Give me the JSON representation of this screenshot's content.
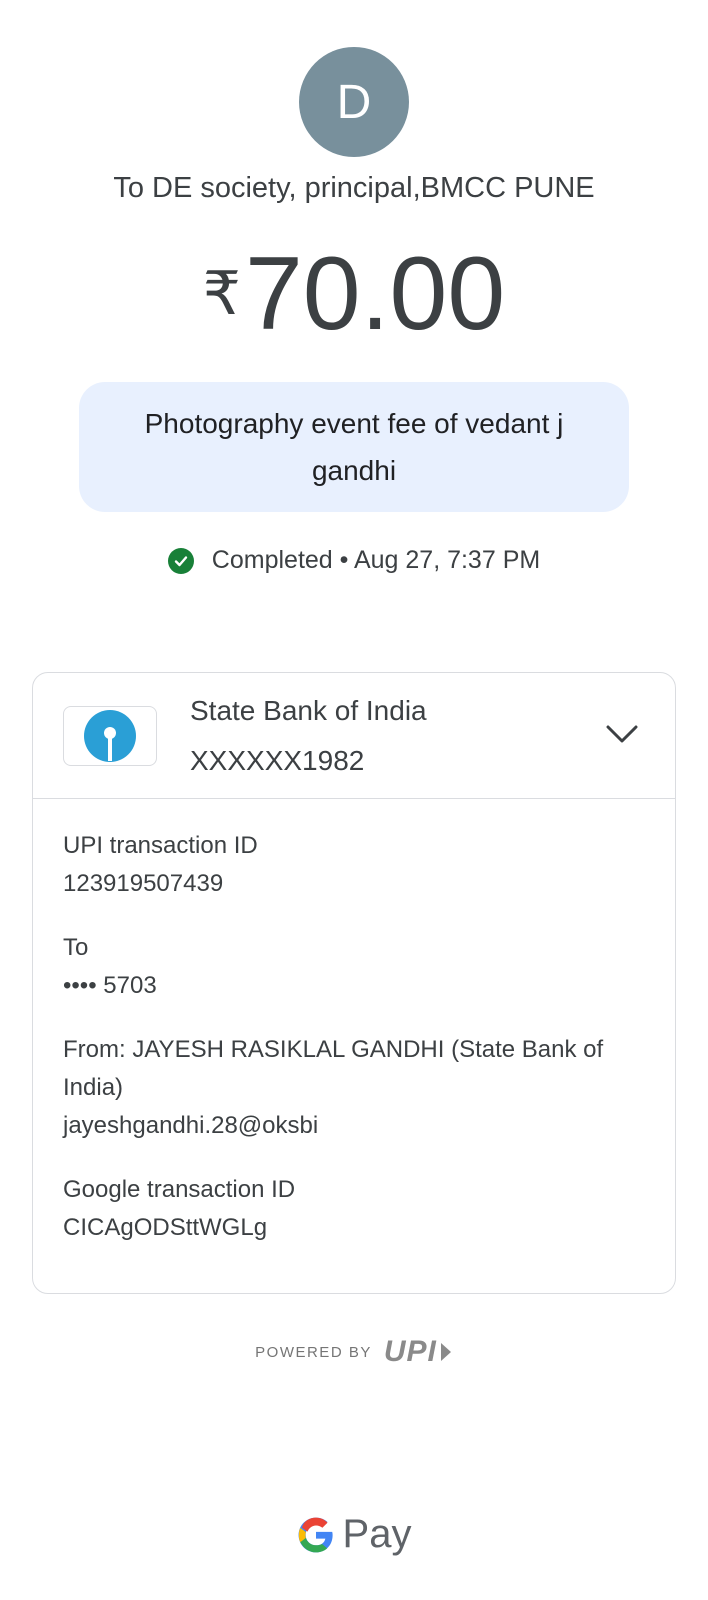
{
  "avatar": {
    "initial": "D",
    "color": "#78909c"
  },
  "payee": {
    "text": "To DE society, principal,BMCC PUNE"
  },
  "amount": {
    "currency": "₹",
    "value": "70.00"
  },
  "note": {
    "text": "Photography event fee of vedant j gandhi"
  },
  "status": {
    "text": "Completed • Aug 27, 7:37 PM",
    "icon": "check-circle-icon",
    "color": "#188038"
  },
  "account": {
    "bank_name": "State Bank of India",
    "masked_number": "XXXXXX1982",
    "logo_icon": "sbi-logo-icon",
    "expand_icon": "chevron-down-icon"
  },
  "details": {
    "upi_label": "UPI transaction ID",
    "upi_value": "123919507439",
    "to_label": "To",
    "to_value": "•••• 5703",
    "from_label": "From: JAYESH RASIKLAL GANDHI (State Bank of India)",
    "from_value": "jayeshgandhi.28@oksbi",
    "google_label": "Google transaction ID",
    "google_value": "CICAgODSttWGLg"
  },
  "footer": {
    "powered_by": "POWERED BY",
    "upi_logo_text": "UPI",
    "brand_pay": "Pay"
  }
}
